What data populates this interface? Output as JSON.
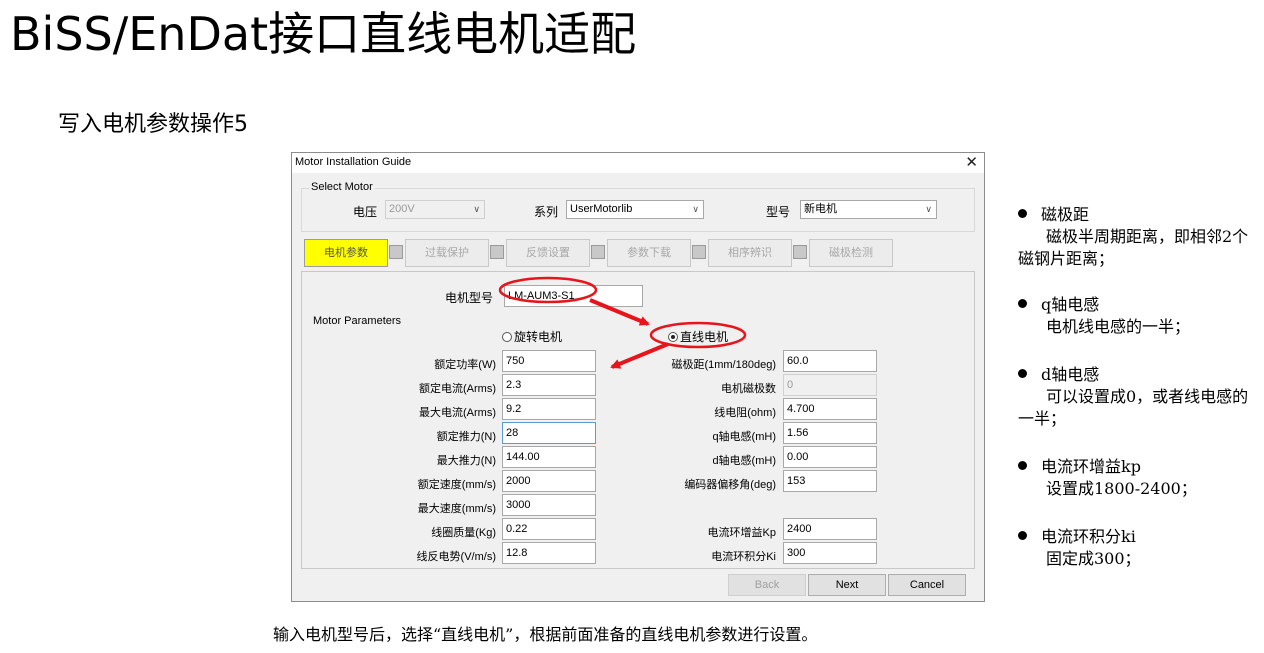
{
  "slide": {
    "title": "BiSS/EnDat接口直线电机适配",
    "subtitle": "写入电机参数操作5",
    "caption": "输入电机型号后，选择“直线电机”，根据前面准备的直线电机参数进行设置。"
  },
  "dialog": {
    "title": "Motor Installation Guide",
    "close_icon": "close-icon",
    "select_motor": {
      "group_label": "Select Motor",
      "voltage_label": "电压",
      "voltage_value": "200V",
      "series_label": "系列",
      "series_value": "UserMotorlib",
      "model_label": "型号",
      "model_value": "新电机"
    },
    "steps": [
      "电机参数",
      "过载保护",
      "反馈设置",
      "参数下载",
      "相序辨识",
      "磁极检测"
    ],
    "motor_model_label": "电机型号",
    "motor_model_value": "LM-AUM3-S1",
    "params_group_label": "Motor Parameters",
    "radio_rotary": "旋转电机",
    "radio_linear": "直线电机",
    "radio_selected": "直线电机",
    "left_params": [
      {
        "label": "额定功率(W)",
        "value": "750"
      },
      {
        "label": "额定电流(Arms)",
        "value": "2.3"
      },
      {
        "label": "最大电流(Arms)",
        "value": "9.2"
      },
      {
        "label": "额定推力(N)",
        "value": "28"
      },
      {
        "label": "最大推力(N)",
        "value": "144.00"
      },
      {
        "label": "额定速度(mm/s)",
        "value": "2000"
      },
      {
        "label": "最大速度(mm/s)",
        "value": "3000"
      },
      {
        "label": "线圈质量(Kg)",
        "value": "0.22"
      },
      {
        "label": "线反电势(V/m/s)",
        "value": "12.8"
      }
    ],
    "right_params": [
      {
        "label": "磁极距(1mm/180deg)",
        "value": "60.0"
      },
      {
        "label": "电机磁极数",
        "value": "0"
      },
      {
        "label": "线电阻(ohm)",
        "value": "4.700"
      },
      {
        "label": "q轴电感(mH)",
        "value": "1.56"
      },
      {
        "label": "d轴电感(mH)",
        "value": "0.00"
      },
      {
        "label": "编码器偏移角(deg)",
        "value": "153"
      },
      {
        "label": "电流环增益Kp",
        "value": "2400"
      },
      {
        "label": "电流环积分Ki",
        "value": "300"
      }
    ],
    "buttons": {
      "back": "Back",
      "next": "Next",
      "cancel": "Cancel"
    }
  },
  "notes": [
    {
      "head": "磁极距",
      "body": "磁极半周期距离，即相邻2个磁钢片距离；"
    },
    {
      "head": "q轴电感",
      "body": "电机线电感的一半；"
    },
    {
      "head": "d轴电感",
      "body": "可以设置成0，或者线电感的一半；"
    },
    {
      "head": "电流环增益kp",
      "body": "设置成1800-2400；"
    },
    {
      "head": "电流环积分ki",
      "body": "固定成300；"
    }
  ],
  "annotation_color": "#e8141b"
}
